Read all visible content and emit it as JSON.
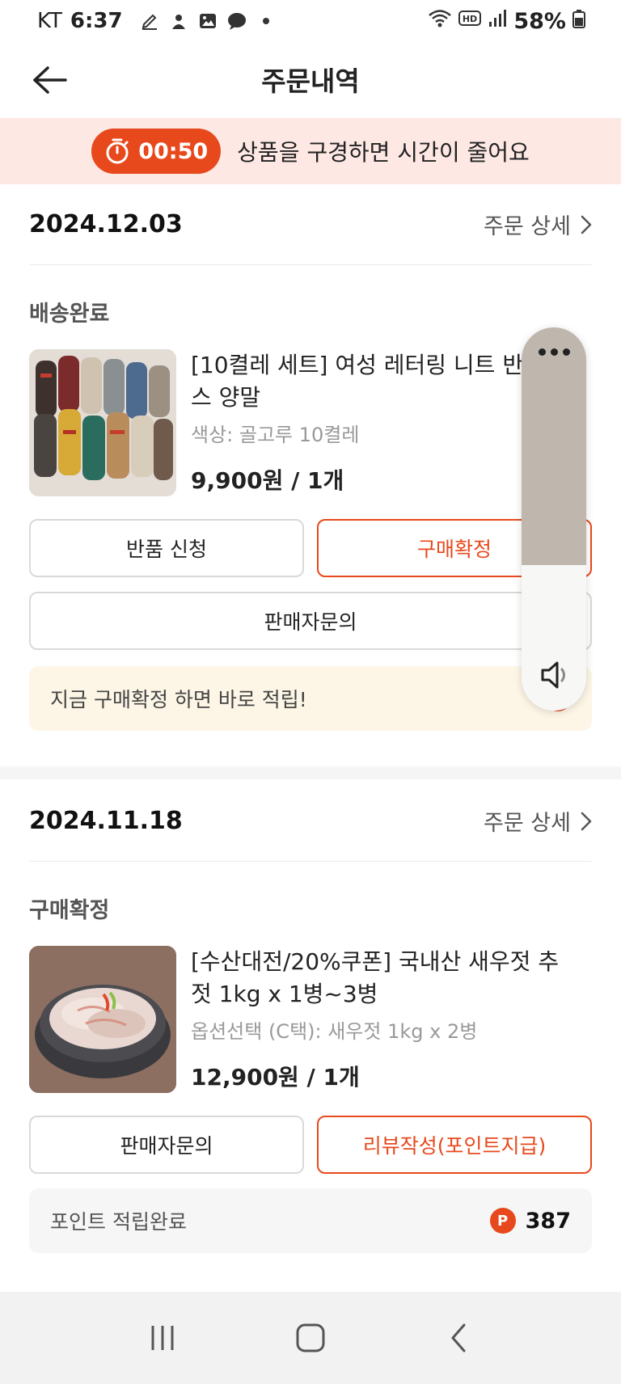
{
  "status_bar": {
    "carrier": "KT",
    "time": "6:37",
    "battery": "58%",
    "notification_icons": [
      "edit-icon",
      "assistant-icon",
      "gallery-icon",
      "chat-icon",
      "dot-icon"
    ],
    "system_icons": [
      "wifi-icon",
      "hd-icon",
      "signal-icon",
      "battery-icon"
    ]
  },
  "header": {
    "title": "주문내역",
    "back_icon": "arrow-left-icon"
  },
  "timer_banner": {
    "timer": "00:50",
    "message": "상품을 구경하면 시간이 줄어요",
    "icon": "stopwatch-icon"
  },
  "orders": [
    {
      "date": "2024.12.03",
      "detail_link": "주문 상세",
      "status": "배송완료",
      "product_name": "[10켤레 세트] 여성 레터링 니트 반삭스 양말",
      "product_name_visible": "[10켤레 세트] 여성 레터링 니트 반",
      "product_name_line2": "스 양말",
      "option": "색상: 골고루 10켤레",
      "price": "9,900원 / 1개",
      "buttons": [
        "반품 신청",
        "구매확정",
        "판매자문의"
      ],
      "info": "지금 구매확정 하면 바로 적립!"
    },
    {
      "date": "2024.11.18",
      "detail_link": "주문 상세",
      "status": "구매확정",
      "product_name_visible": "[수산대전/20%쿠폰] 국내산 새우젓 추",
      "product_name_line2": "젓 1kg x 1병~3병",
      "option": "옵션선택 (C택): 새우젓 1kg x 2병",
      "price": "12,900원 / 1개",
      "buttons": [
        "판매자문의",
        "리뷰작성(포인트지급)"
      ],
      "info": "포인트 적립완료",
      "points": "387"
    }
  ],
  "point_badge": "P",
  "volume_overlay": {
    "level_fraction": 0.62,
    "more_icon": "more-dots-icon",
    "speaker_icon": "speaker-icon"
  },
  "nav_bar": {
    "buttons": [
      "recent-apps-icon",
      "home-icon",
      "back-nav-icon"
    ]
  },
  "colors": {
    "accent": "#e8491c",
    "banner_bg": "#fde8e4",
    "info_yellow": "#fdf6e6",
    "info_gray": "#f6f6f6",
    "volume_fill": "#bfb6ae"
  }
}
